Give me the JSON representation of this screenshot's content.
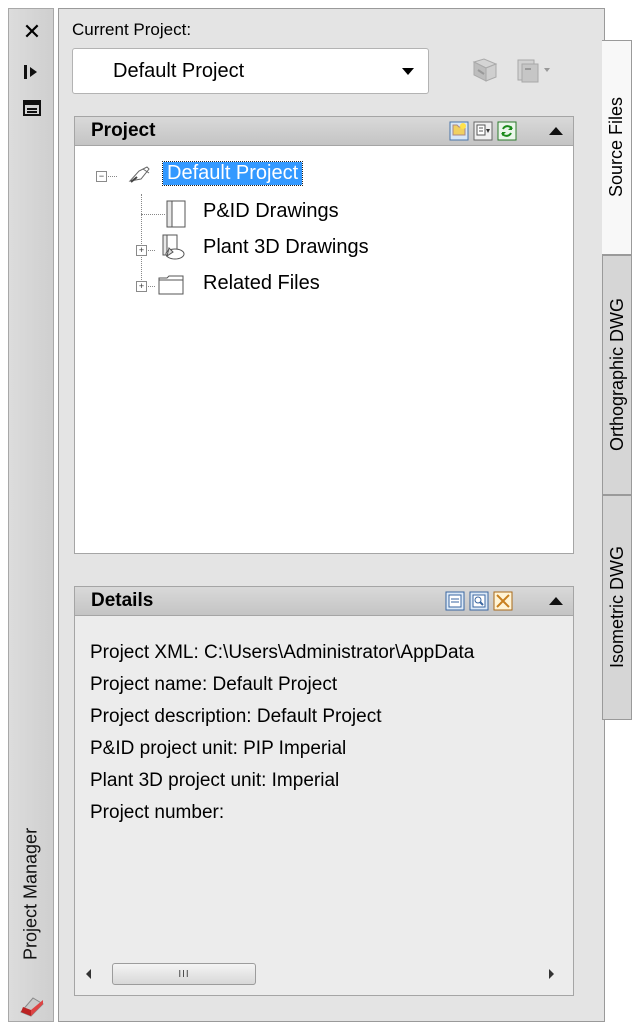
{
  "toolbar": {
    "close_glyph": "✕",
    "autohide_glyph": "⇤",
    "properties_glyph": "☰"
  },
  "palette_title": "Project Manager",
  "current_project": {
    "label": "Current Project:",
    "selected": "Default Project"
  },
  "project_section": {
    "title": "Project",
    "tree": [
      {
        "label": "Default Project",
        "selected": true,
        "icon": "project-icon",
        "expander": "−"
      },
      {
        "label": "P&ID Drawings",
        "icon": "pid-drawings-icon",
        "expander": ""
      },
      {
        "label": "Plant 3D Drawings",
        "icon": "plant3d-drawings-icon",
        "expander": "+"
      },
      {
        "label": "Related Files",
        "icon": "folder-icon",
        "expander": "+"
      }
    ]
  },
  "details_section": {
    "title": "Details",
    "lines": [
      "Project XML:  C:\\Users\\Administrator\\AppData",
      "Project name: Default Project",
      "Project description: Default Project",
      "P&ID project unit: PIP Imperial",
      "Plant 3D project unit: Imperial",
      "Project number:"
    ]
  },
  "scrollbar": {
    "thumb_grip": "III"
  },
  "tabs": [
    {
      "label": "Source Files",
      "active": true
    },
    {
      "label": "Orthographic DWG",
      "active": false
    },
    {
      "label": "Isometric DWG",
      "active": false
    }
  ],
  "colors": {
    "selection": "#3399ff",
    "panel": "#e4e4e4",
    "header": "#c8c8c8"
  }
}
